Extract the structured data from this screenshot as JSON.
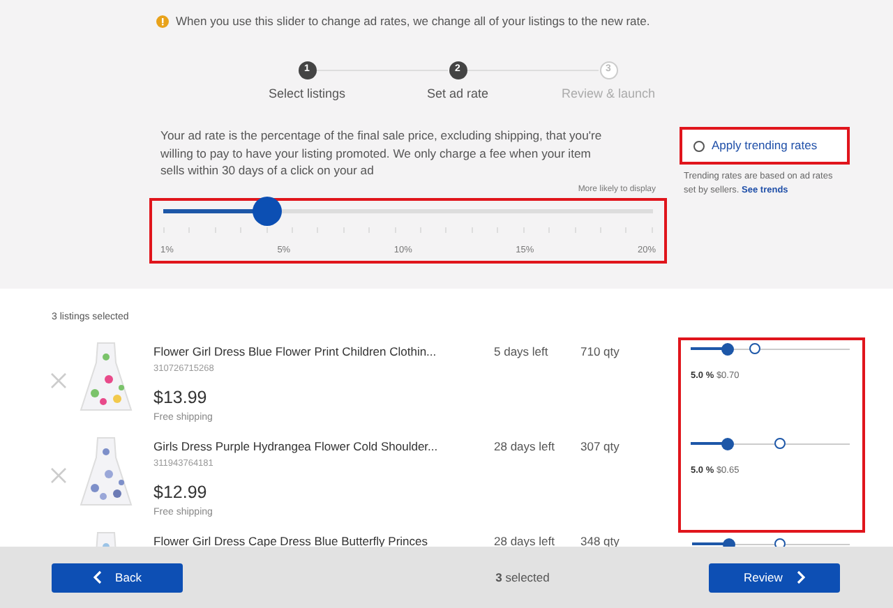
{
  "notice": {
    "text": "When you use this slider to change ad rates, we change all of your listings to the new rate."
  },
  "steps": [
    {
      "number": "1",
      "label": "Select listings",
      "reached": true
    },
    {
      "number": "2",
      "label": "Set ad rate",
      "reached": true
    },
    {
      "number": "3",
      "label": "Review & launch",
      "reached": false
    }
  ],
  "rate_slider": {
    "description": "Your ad rate is the percentage of the final sale price, excluding shipping, that you're willing to pay to have your listing promoted. We only charge a fee when your item sells within 30 days of a click on your ad",
    "hint": "More likely to display",
    "level": 0.21,
    "ticks": [
      "1%",
      "5%",
      "10%",
      "15%",
      "20%"
    ],
    "highlighted": true
  },
  "trending": {
    "label": "Apply trending rates",
    "checked": false,
    "note": "Trending rates are based on ad rates set by sellers.",
    "link": "See trends",
    "highlighted": true
  },
  "listings_count": "3 listings selected",
  "listings": [
    {
      "title": "Flower Girl Dress Blue Flower Print Children Clothin...",
      "item_id": "310726715268",
      "price": "$13.99",
      "shipping": "Free shipping",
      "time_left": "5 days left",
      "quantity": "710 qty",
      "level": 0.23,
      "trend_marker": {
        "level": 0.4
      },
      "rate": "5.0 %",
      "fee": "$0.70",
      "highlighted": true
    },
    {
      "title": "Girls Dress Purple Hydrangea Flower Cold Shoulder...",
      "item_id": "311943764181",
      "price": "$12.99",
      "shipping": "Free shipping",
      "time_left": "28 days left",
      "quantity": "307 qty",
      "level": 0.23,
      "trend_marker": {
        "level": 0.56
      },
      "rate": "5.0 %",
      "fee": "$0.65",
      "highlighted": true
    },
    {
      "title": "Flower Girl Dress Cape Dress Blue Butterfly Princes",
      "time_left": "28 days left",
      "quantity": "348 qty",
      "level": 0.23,
      "trend_marker": {
        "level": 0.56
      },
      "highlighted": false
    }
  ],
  "footer": {
    "back": "Back",
    "selected": "**3** selected",
    "review": "Review"
  }
}
